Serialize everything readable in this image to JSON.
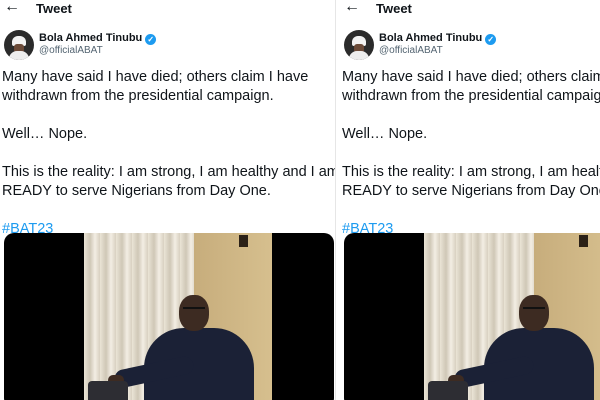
{
  "header": {
    "back_icon": "arrow-left-icon",
    "title": "Tweet"
  },
  "author": {
    "name": "Bola Ahmed Tinubu",
    "handle": "@officialABAT",
    "verified_icon": "verified-check-icon"
  },
  "tweet": {
    "line1": "Many have said I have died; others claim I have",
    "line2": "withdrawn from the presidential campaign.",
    "line3": "Well… Nope.",
    "line4": "This is the reality: I am strong, I am healthy and I am",
    "line5": "READY to serve Nigerians from Day One.",
    "hashtag": "#BAT23"
  },
  "colors": {
    "accent": "#1d9bf0",
    "text": "#0f1419",
    "secondary": "#536471"
  }
}
